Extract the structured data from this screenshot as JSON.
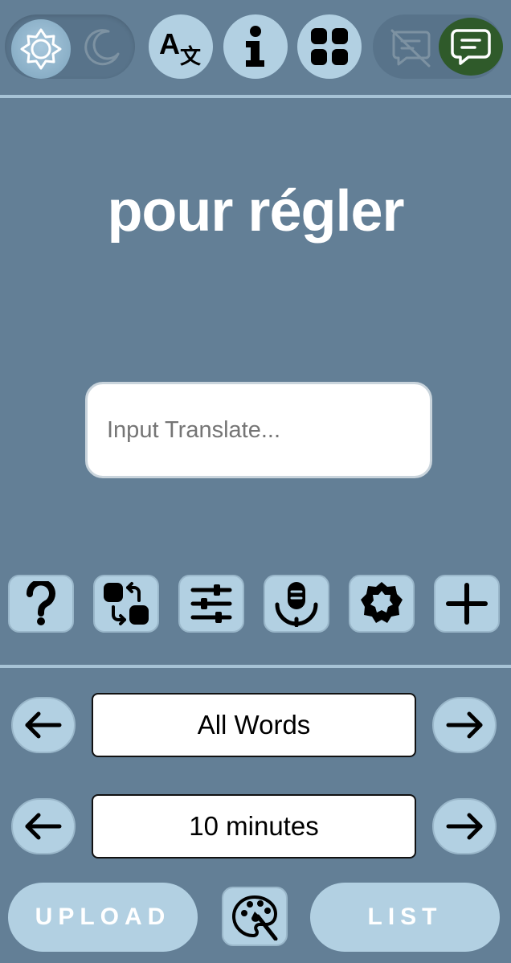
{
  "header": {
    "theme": {
      "light_icon": "sun-icon",
      "dark_icon": "moon-icon",
      "active": "light"
    },
    "buttons": [
      {
        "icon": "translate-icon"
      },
      {
        "icon": "info-icon"
      },
      {
        "icon": "apps-grid-icon"
      }
    ],
    "chat": {
      "off_icon": "chat-off-icon",
      "on_icon": "chat-icon",
      "active": "on",
      "active_color": "#2f5a2a"
    }
  },
  "main": {
    "word": "pour régler",
    "input": {
      "placeholder": "Input Translate...",
      "value": ""
    }
  },
  "toolbar": [
    {
      "icon": "question-icon"
    },
    {
      "icon": "swap-icon"
    },
    {
      "icon": "sliders-icon"
    },
    {
      "icon": "microphone-icon"
    },
    {
      "icon": "badge-icon"
    },
    {
      "icon": "plus-icon"
    }
  ],
  "selectors": {
    "word_filter": {
      "value": "All Words",
      "prev_icon": "arrow-left-icon",
      "next_icon": "arrow-right-icon"
    },
    "duration": {
      "value": "10 minutes",
      "prev_icon": "arrow-left-icon",
      "next_icon": "arrow-right-icon"
    }
  },
  "footer": {
    "upload_label": "UPLOAD",
    "palette_icon": "palette-icon",
    "list_label": "LIST"
  },
  "colors": {
    "background": "#637f96",
    "button": "#b2d0e2",
    "divider": "#a7c3d6"
  }
}
